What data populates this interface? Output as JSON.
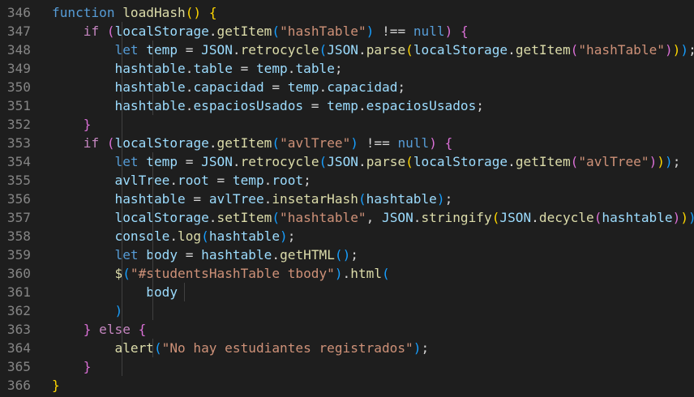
{
  "editor": {
    "line_numbers": [
      "346",
      "347",
      "348",
      "349",
      "350",
      "351",
      "352",
      "353",
      "354",
      "355",
      "356",
      "357",
      "358",
      "359",
      "360",
      "361",
      "362",
      "363",
      "364",
      "365",
      "366"
    ],
    "lines": [
      {
        "id": "346",
        "guides": 0,
        "tokens": [
          {
            "t": "function",
            "c": "kw"
          },
          {
            "t": " ",
            "c": "pl"
          },
          {
            "t": "loadHash",
            "c": "fn"
          },
          {
            "t": "()",
            "c": "b1"
          },
          {
            "t": " ",
            "c": "pl"
          },
          {
            "t": "{",
            "c": "b1"
          }
        ]
      },
      {
        "id": "347",
        "guides": 1,
        "tokens": [
          {
            "t": "    ",
            "c": "pl"
          },
          {
            "t": "if",
            "c": "ctl"
          },
          {
            "t": " ",
            "c": "pl"
          },
          {
            "t": "(",
            "c": "b2"
          },
          {
            "t": "localStorage",
            "c": "var"
          },
          {
            "t": ".",
            "c": "pl"
          },
          {
            "t": "getItem",
            "c": "fn"
          },
          {
            "t": "(",
            "c": "b3"
          },
          {
            "t": "\"hashTable\"",
            "c": "str"
          },
          {
            "t": ")",
            "c": "b3"
          },
          {
            "t": " !== ",
            "c": "pl"
          },
          {
            "t": "null",
            "c": "kw"
          },
          {
            "t": ")",
            "c": "b2"
          },
          {
            "t": " ",
            "c": "pl"
          },
          {
            "t": "{",
            "c": "b2"
          }
        ]
      },
      {
        "id": "348",
        "guides": 2,
        "tokens": [
          {
            "t": "        ",
            "c": "pl"
          },
          {
            "t": "let",
            "c": "kw"
          },
          {
            "t": " ",
            "c": "pl"
          },
          {
            "t": "temp",
            "c": "var"
          },
          {
            "t": " = ",
            "c": "pl"
          },
          {
            "t": "JSON",
            "c": "var"
          },
          {
            "t": ".",
            "c": "pl"
          },
          {
            "t": "retrocycle",
            "c": "fn"
          },
          {
            "t": "(",
            "c": "b3"
          },
          {
            "t": "JSON",
            "c": "var"
          },
          {
            "t": ".",
            "c": "pl"
          },
          {
            "t": "parse",
            "c": "fn"
          },
          {
            "t": "(",
            "c": "b1"
          },
          {
            "t": "localStorage",
            "c": "var"
          },
          {
            "t": ".",
            "c": "pl"
          },
          {
            "t": "getItem",
            "c": "fn"
          },
          {
            "t": "(",
            "c": "b2"
          },
          {
            "t": "\"hashTable\"",
            "c": "str"
          },
          {
            "t": ")",
            "c": "b2"
          },
          {
            "t": ")",
            "c": "b1"
          },
          {
            "t": ")",
            "c": "b3"
          },
          {
            "t": ";",
            "c": "pl"
          }
        ]
      },
      {
        "id": "349",
        "guides": 2,
        "tokens": [
          {
            "t": "        ",
            "c": "pl"
          },
          {
            "t": "hashtable",
            "c": "var"
          },
          {
            "t": ".",
            "c": "pl"
          },
          {
            "t": "table",
            "c": "var"
          },
          {
            "t": " = ",
            "c": "pl"
          },
          {
            "t": "temp",
            "c": "var"
          },
          {
            "t": ".",
            "c": "pl"
          },
          {
            "t": "table",
            "c": "var"
          },
          {
            "t": ";",
            "c": "pl"
          }
        ]
      },
      {
        "id": "350",
        "guides": 2,
        "tokens": [
          {
            "t": "        ",
            "c": "pl"
          },
          {
            "t": "hashtable",
            "c": "var"
          },
          {
            "t": ".",
            "c": "pl"
          },
          {
            "t": "capacidad",
            "c": "var"
          },
          {
            "t": " = ",
            "c": "pl"
          },
          {
            "t": "temp",
            "c": "var"
          },
          {
            "t": ".",
            "c": "pl"
          },
          {
            "t": "capacidad",
            "c": "var"
          },
          {
            "t": ";",
            "c": "pl"
          }
        ]
      },
      {
        "id": "351",
        "guides": 2,
        "tokens": [
          {
            "t": "        ",
            "c": "pl"
          },
          {
            "t": "hashtable",
            "c": "var"
          },
          {
            "t": ".",
            "c": "pl"
          },
          {
            "t": "espaciosUsados",
            "c": "var"
          },
          {
            "t": " = ",
            "c": "pl"
          },
          {
            "t": "temp",
            "c": "var"
          },
          {
            "t": ".",
            "c": "pl"
          },
          {
            "t": "espaciosUsados",
            "c": "var"
          },
          {
            "t": ";",
            "c": "pl"
          }
        ]
      },
      {
        "id": "352",
        "guides": 1,
        "tokens": [
          {
            "t": "    ",
            "c": "pl"
          },
          {
            "t": "}",
            "c": "b2"
          }
        ]
      },
      {
        "id": "353",
        "guides": 1,
        "tokens": [
          {
            "t": "    ",
            "c": "pl"
          },
          {
            "t": "if",
            "c": "ctl"
          },
          {
            "t": " ",
            "c": "pl"
          },
          {
            "t": "(",
            "c": "b2"
          },
          {
            "t": "localStorage",
            "c": "var"
          },
          {
            "t": ".",
            "c": "pl"
          },
          {
            "t": "getItem",
            "c": "fn"
          },
          {
            "t": "(",
            "c": "b3"
          },
          {
            "t": "\"avlTree\"",
            "c": "str"
          },
          {
            "t": ")",
            "c": "b3"
          },
          {
            "t": " !== ",
            "c": "pl"
          },
          {
            "t": "null",
            "c": "kw"
          },
          {
            "t": ")",
            "c": "b2"
          },
          {
            "t": " ",
            "c": "pl"
          },
          {
            "t": "{",
            "c": "b2"
          }
        ]
      },
      {
        "id": "354",
        "guides": 2,
        "tokens": [
          {
            "t": "        ",
            "c": "pl"
          },
          {
            "t": "let",
            "c": "kw"
          },
          {
            "t": " ",
            "c": "pl"
          },
          {
            "t": "temp",
            "c": "var"
          },
          {
            "t": " = ",
            "c": "pl"
          },
          {
            "t": "JSON",
            "c": "var"
          },
          {
            "t": ".",
            "c": "pl"
          },
          {
            "t": "retrocycle",
            "c": "fn"
          },
          {
            "t": "(",
            "c": "b3"
          },
          {
            "t": "JSON",
            "c": "var"
          },
          {
            "t": ".",
            "c": "pl"
          },
          {
            "t": "parse",
            "c": "fn"
          },
          {
            "t": "(",
            "c": "b1"
          },
          {
            "t": "localStorage",
            "c": "var"
          },
          {
            "t": ".",
            "c": "pl"
          },
          {
            "t": "getItem",
            "c": "fn"
          },
          {
            "t": "(",
            "c": "b2"
          },
          {
            "t": "\"avlTree\"",
            "c": "str"
          },
          {
            "t": ")",
            "c": "b2"
          },
          {
            "t": ")",
            "c": "b1"
          },
          {
            "t": ")",
            "c": "b3"
          },
          {
            "t": ";",
            "c": "pl"
          }
        ]
      },
      {
        "id": "355",
        "guides": 2,
        "tokens": [
          {
            "t": "        ",
            "c": "pl"
          },
          {
            "t": "avlTree",
            "c": "var"
          },
          {
            "t": ".",
            "c": "pl"
          },
          {
            "t": "root",
            "c": "var"
          },
          {
            "t": " = ",
            "c": "pl"
          },
          {
            "t": "temp",
            "c": "var"
          },
          {
            "t": ".",
            "c": "pl"
          },
          {
            "t": "root",
            "c": "var"
          },
          {
            "t": ";",
            "c": "pl"
          }
        ]
      },
      {
        "id": "356",
        "guides": 2,
        "tokens": [
          {
            "t": "        ",
            "c": "pl"
          },
          {
            "t": "hashtable",
            "c": "var"
          },
          {
            "t": " = ",
            "c": "pl"
          },
          {
            "t": "avlTree",
            "c": "var"
          },
          {
            "t": ".",
            "c": "pl"
          },
          {
            "t": "insetarHash",
            "c": "fn"
          },
          {
            "t": "(",
            "c": "b3"
          },
          {
            "t": "hashtable",
            "c": "var"
          },
          {
            "t": ")",
            "c": "b3"
          },
          {
            "t": ";",
            "c": "pl"
          }
        ]
      },
      {
        "id": "357",
        "guides": 2,
        "tokens": [
          {
            "t": "        ",
            "c": "pl"
          },
          {
            "t": "localStorage",
            "c": "var"
          },
          {
            "t": ".",
            "c": "pl"
          },
          {
            "t": "setItem",
            "c": "fn"
          },
          {
            "t": "(",
            "c": "b3"
          },
          {
            "t": "\"hashtable\"",
            "c": "str"
          },
          {
            "t": ", ",
            "c": "pl"
          },
          {
            "t": "JSON",
            "c": "var"
          },
          {
            "t": ".",
            "c": "pl"
          },
          {
            "t": "stringify",
            "c": "fn"
          },
          {
            "t": "(",
            "c": "b1"
          },
          {
            "t": "JSON",
            "c": "var"
          },
          {
            "t": ".",
            "c": "pl"
          },
          {
            "t": "decycle",
            "c": "fn"
          },
          {
            "t": "(",
            "c": "b2"
          },
          {
            "t": "hashtable",
            "c": "var"
          },
          {
            "t": ")",
            "c": "b2"
          },
          {
            "t": ")",
            "c": "b1"
          },
          {
            "t": ")",
            "c": "b3"
          },
          {
            "t": ";",
            "c": "pl"
          }
        ]
      },
      {
        "id": "358",
        "guides": 2,
        "tokens": [
          {
            "t": "        ",
            "c": "pl"
          },
          {
            "t": "console",
            "c": "var"
          },
          {
            "t": ".",
            "c": "pl"
          },
          {
            "t": "log",
            "c": "fn"
          },
          {
            "t": "(",
            "c": "b3"
          },
          {
            "t": "hashtable",
            "c": "var"
          },
          {
            "t": ")",
            "c": "b3"
          },
          {
            "t": ";",
            "c": "pl"
          }
        ]
      },
      {
        "id": "359",
        "guides": 2,
        "tokens": [
          {
            "t": "        ",
            "c": "pl"
          },
          {
            "t": "let",
            "c": "kw"
          },
          {
            "t": " ",
            "c": "pl"
          },
          {
            "t": "body",
            "c": "var"
          },
          {
            "t": " = ",
            "c": "pl"
          },
          {
            "t": "hashtable",
            "c": "var"
          },
          {
            "t": ".",
            "c": "pl"
          },
          {
            "t": "getHTML",
            "c": "fn"
          },
          {
            "t": "()",
            "c": "b3"
          },
          {
            "t": ";",
            "c": "pl"
          }
        ]
      },
      {
        "id": "360",
        "guides": 2,
        "tokens": [
          {
            "t": "        ",
            "c": "pl"
          },
          {
            "t": "$",
            "c": "fn"
          },
          {
            "t": "(",
            "c": "b3"
          },
          {
            "t": "\"#studentsHashTable tbody\"",
            "c": "str"
          },
          {
            "t": ")",
            "c": "b3"
          },
          {
            "t": ".",
            "c": "pl"
          },
          {
            "t": "html",
            "c": "fn"
          },
          {
            "t": "(",
            "c": "b3"
          }
        ]
      },
      {
        "id": "361",
        "guides": 3,
        "tokens": [
          {
            "t": "            ",
            "c": "pl"
          },
          {
            "t": "body",
            "c": "var"
          }
        ]
      },
      {
        "id": "362",
        "guides": 2,
        "tokens": [
          {
            "t": "        ",
            "c": "pl"
          },
          {
            "t": ")",
            "c": "b3"
          }
        ]
      },
      {
        "id": "363",
        "guides": 1,
        "tokens": [
          {
            "t": "    ",
            "c": "pl"
          },
          {
            "t": "}",
            "c": "b2"
          },
          {
            "t": " ",
            "c": "pl"
          },
          {
            "t": "else",
            "c": "ctl"
          },
          {
            "t": " ",
            "c": "pl"
          },
          {
            "t": "{",
            "c": "b2"
          }
        ]
      },
      {
        "id": "364",
        "guides": 2,
        "tokens": [
          {
            "t": "        ",
            "c": "pl"
          },
          {
            "t": "alert",
            "c": "fn"
          },
          {
            "t": "(",
            "c": "b3"
          },
          {
            "t": "\"No hay estudiantes registrados\"",
            "c": "str"
          },
          {
            "t": ")",
            "c": "b3"
          },
          {
            "t": ";",
            "c": "pl"
          }
        ]
      },
      {
        "id": "365",
        "guides": 1,
        "tokens": [
          {
            "t": "    ",
            "c": "pl"
          },
          {
            "t": "}",
            "c": "b2"
          }
        ]
      },
      {
        "id": "366",
        "guides": 0,
        "tokens": [
          {
            "t": "}",
            "c": "b1"
          }
        ]
      }
    ]
  }
}
